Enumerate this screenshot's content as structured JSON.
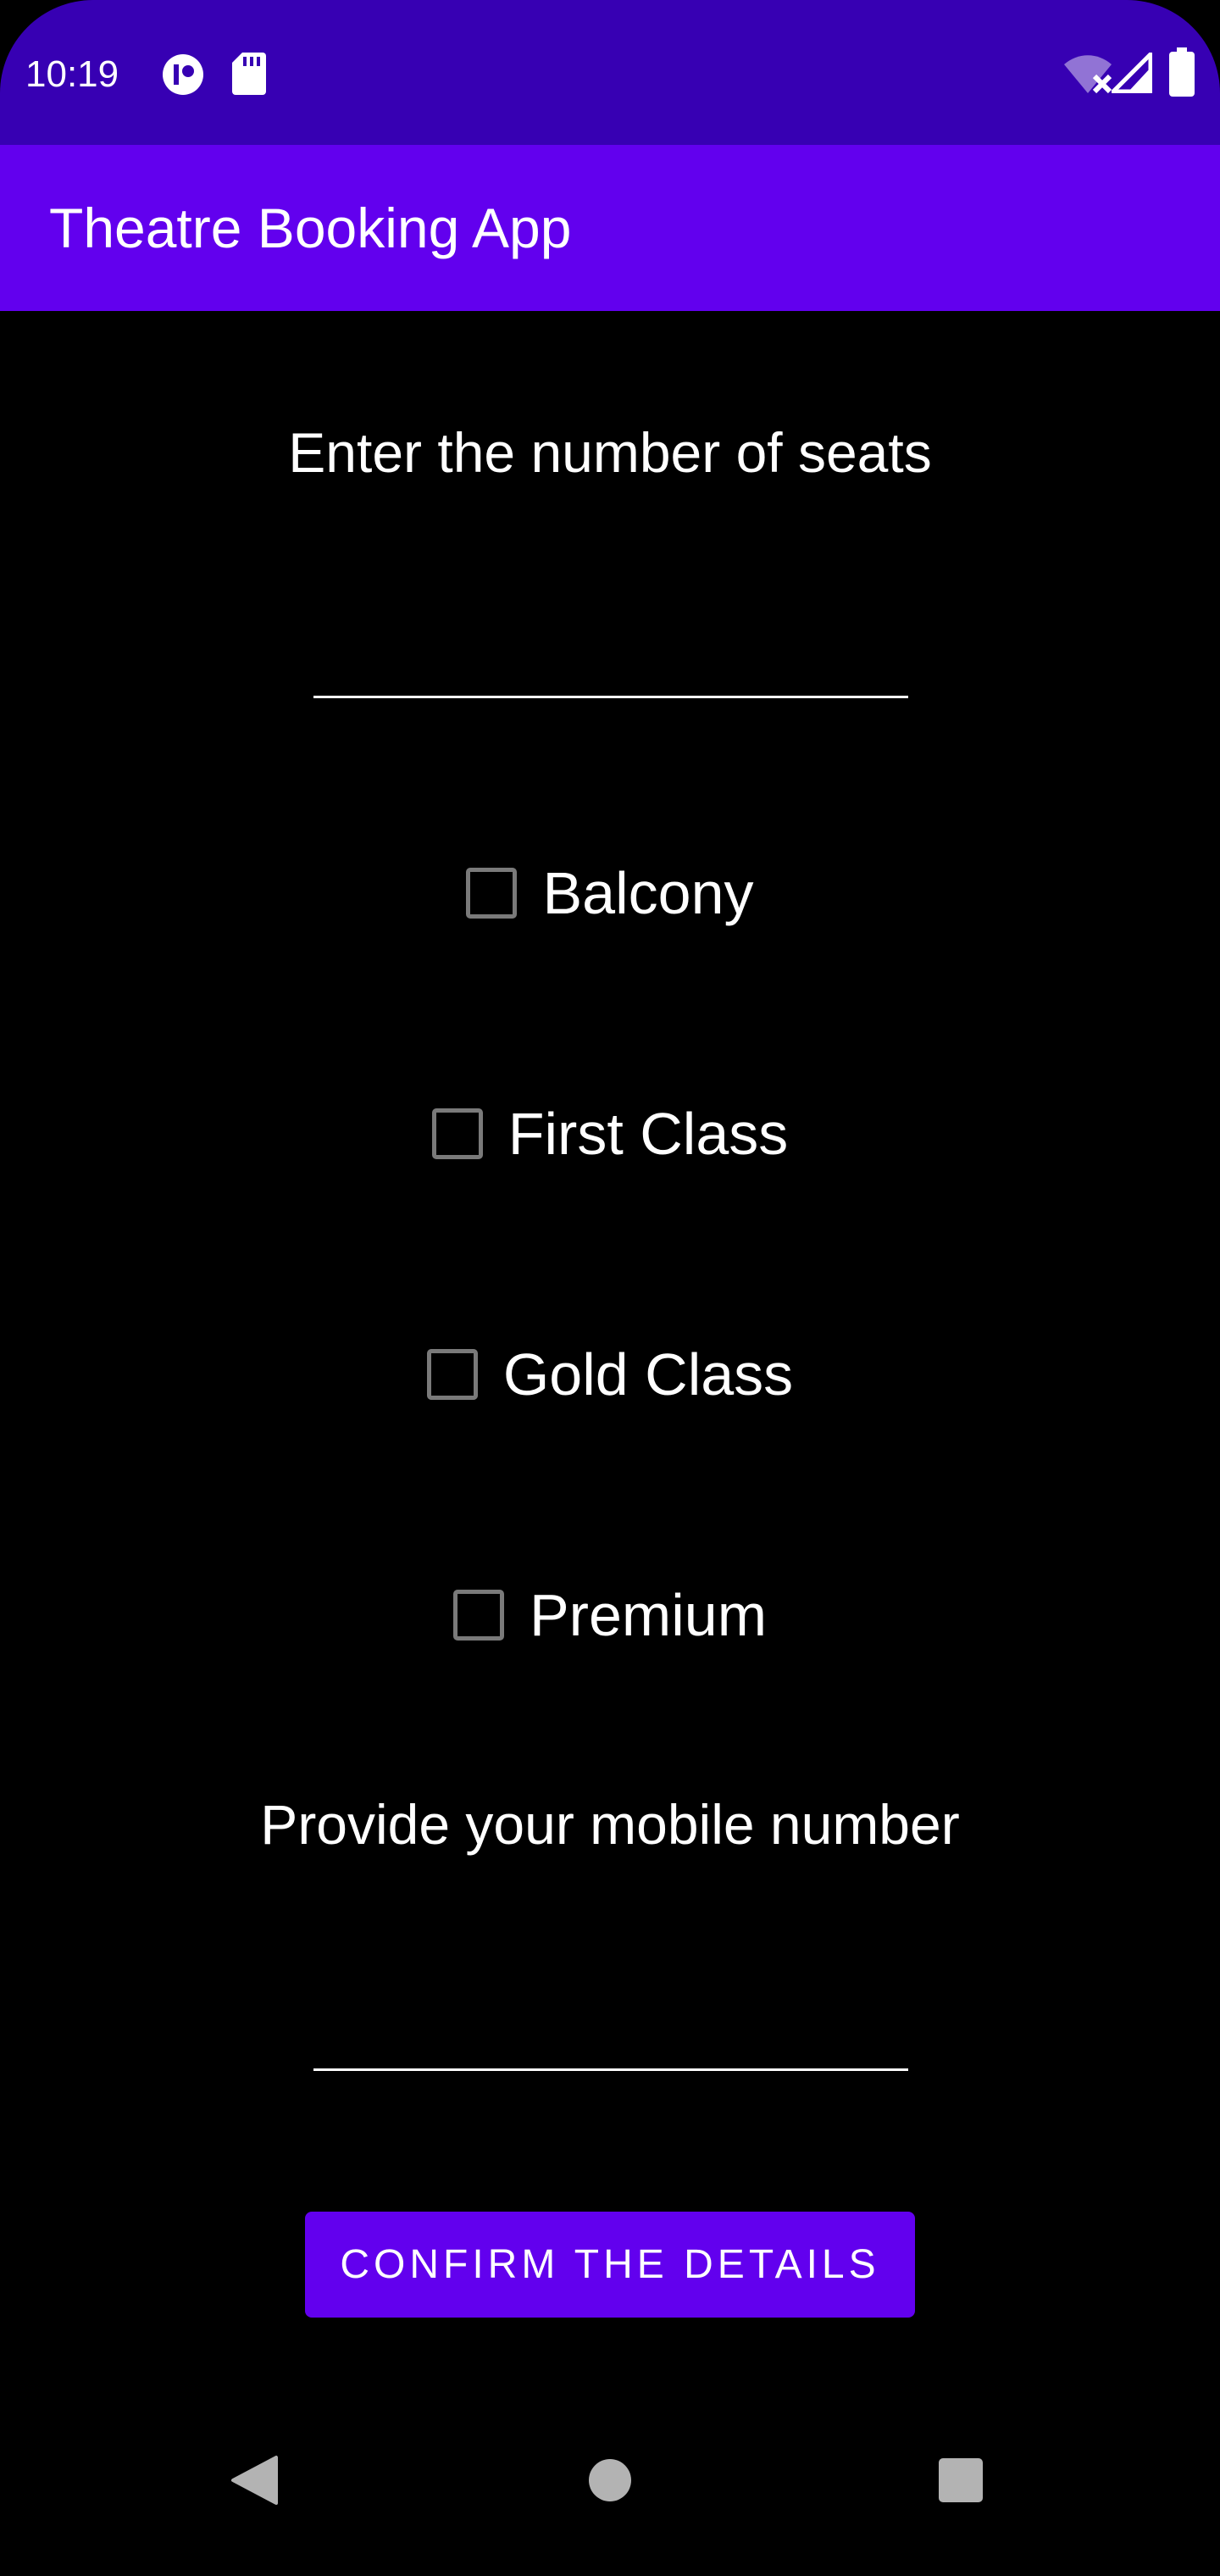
{
  "status_bar": {
    "time": "10:19",
    "left_icons": [
      "app-notification-icon",
      "sd-card-icon"
    ],
    "right_icons": [
      "wifi-off-icon",
      "signal-icon",
      "battery-icon"
    ]
  },
  "app_bar": {
    "title": "Theatre Booking App"
  },
  "form": {
    "seats_label": "Enter the number of seats",
    "seats_value": "",
    "options": [
      {
        "label": "Balcony",
        "checked": false
      },
      {
        "label": "First Class",
        "checked": false
      },
      {
        "label": "Gold Class",
        "checked": false
      },
      {
        "label": "Premium",
        "checked": false
      }
    ],
    "mobile_label": "Provide your mobile number",
    "mobile_value": "",
    "confirm_label": "CONFIRM THE DETAILS"
  },
  "nav_bar": {
    "icons": [
      "back-icon",
      "home-icon",
      "recents-icon"
    ]
  },
  "colors": {
    "status_bar": "#3700b3",
    "app_bar": "#6200ee",
    "button": "#6200ee",
    "background": "#000000",
    "checkbox_border": "#7a7a7a"
  }
}
